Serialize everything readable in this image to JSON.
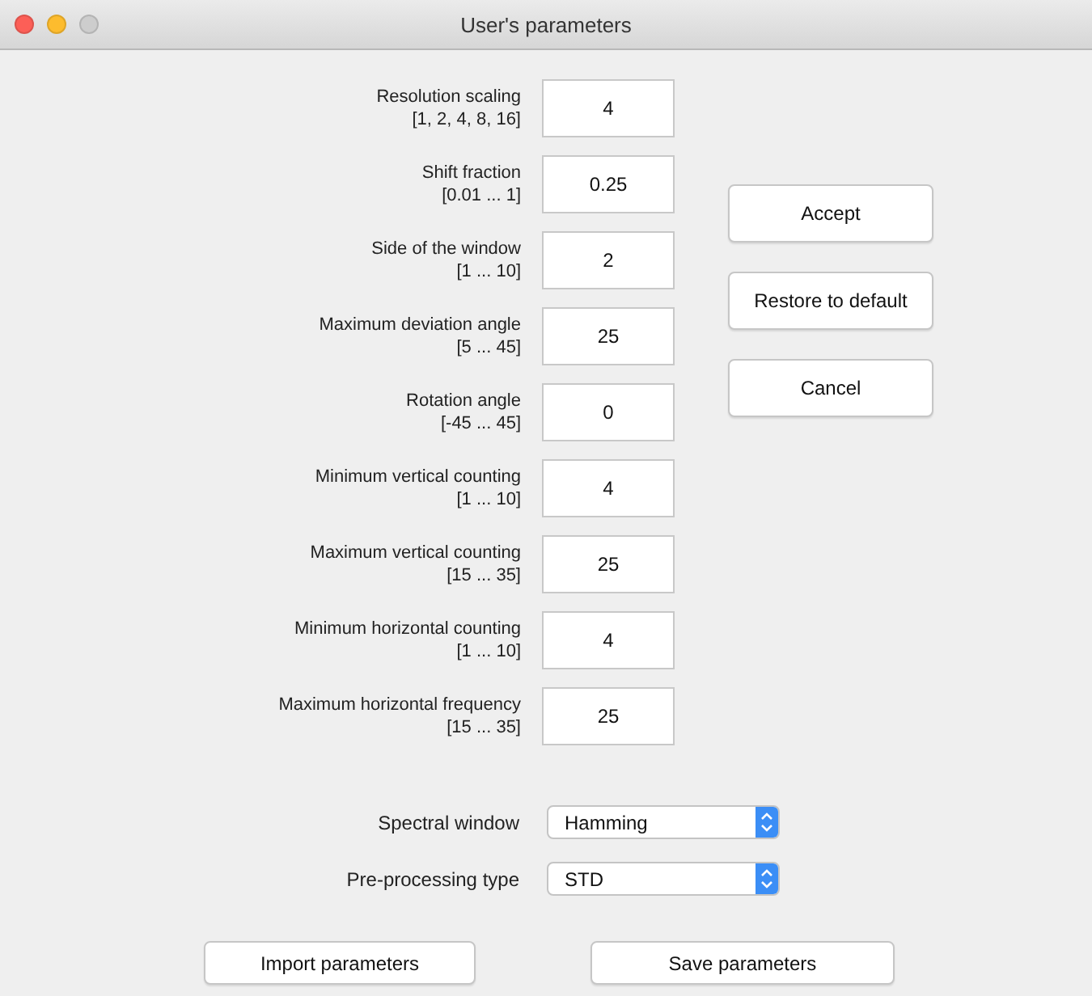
{
  "window": {
    "title": "User's parameters"
  },
  "parameters": [
    {
      "label": "Resolution scaling",
      "range": "[1, 2, 4, 8, 16]",
      "value": "4"
    },
    {
      "label": "Shift fraction",
      "range": "[0.01 ... 1]",
      "value": "0.25"
    },
    {
      "label": "Side of the window",
      "range": "[1 ... 10]",
      "value": "2"
    },
    {
      "label": "Maximum deviation angle",
      "range": "[5 ... 45]",
      "value": "25"
    },
    {
      "label": "Rotation angle",
      "range": "[-45 ... 45]",
      "value": "0"
    },
    {
      "label": "Minimum vertical counting",
      "range": "[1 ... 10]",
      "value": "4"
    },
    {
      "label": "Maximum vertical counting",
      "range": "[15 ... 35]",
      "value": "25"
    },
    {
      "label": "Minimum horizontal counting",
      "range": "[1 ... 10]",
      "value": "4"
    },
    {
      "label": "Maximum horizontal frequency",
      "range": "[15 ... 35]",
      "value": "25"
    }
  ],
  "side_buttons": [
    "Accept",
    "Restore to default",
    "Cancel"
  ],
  "selects": [
    {
      "label": "Spectral window",
      "value": "Hamming"
    },
    {
      "label": "Pre-processing type",
      "value": "STD"
    }
  ],
  "bottom_buttons": [
    "Import parameters",
    "Save parameters"
  ]
}
